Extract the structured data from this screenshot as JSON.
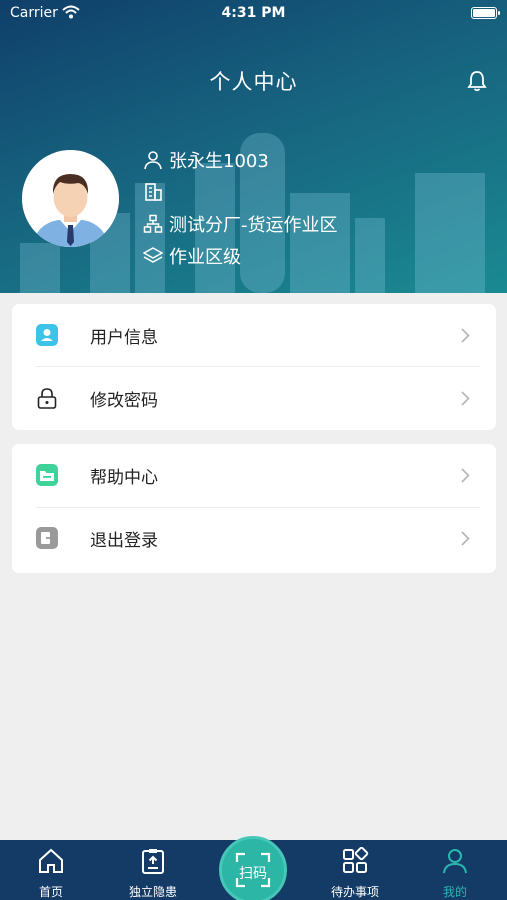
{
  "status_bar": {
    "carrier": "Carrier",
    "time": "4:31 PM"
  },
  "header": {
    "title": "个人中心"
  },
  "profile": {
    "name": "张永生1003",
    "company": "",
    "department": "测试分厂-货运作业区",
    "level": "作业区级"
  },
  "menu_group_1": [
    {
      "label": "用户信息",
      "icon": "user-info-icon"
    },
    {
      "label": "修改密码",
      "icon": "lock-icon"
    }
  ],
  "menu_group_2": [
    {
      "label": "帮助中心",
      "icon": "help-folder-icon"
    },
    {
      "label": "退出登录",
      "icon": "logout-icon"
    }
  ],
  "tabbar": {
    "home": "首页",
    "hazard": "独立隐患",
    "scan": "扫码",
    "todo": "待办事项",
    "mine": "我的"
  },
  "colors": {
    "header_start": "#0f3f6a",
    "header_end": "#1a8a92",
    "tabbar": "#143a66",
    "accent": "#2bb6a6"
  }
}
